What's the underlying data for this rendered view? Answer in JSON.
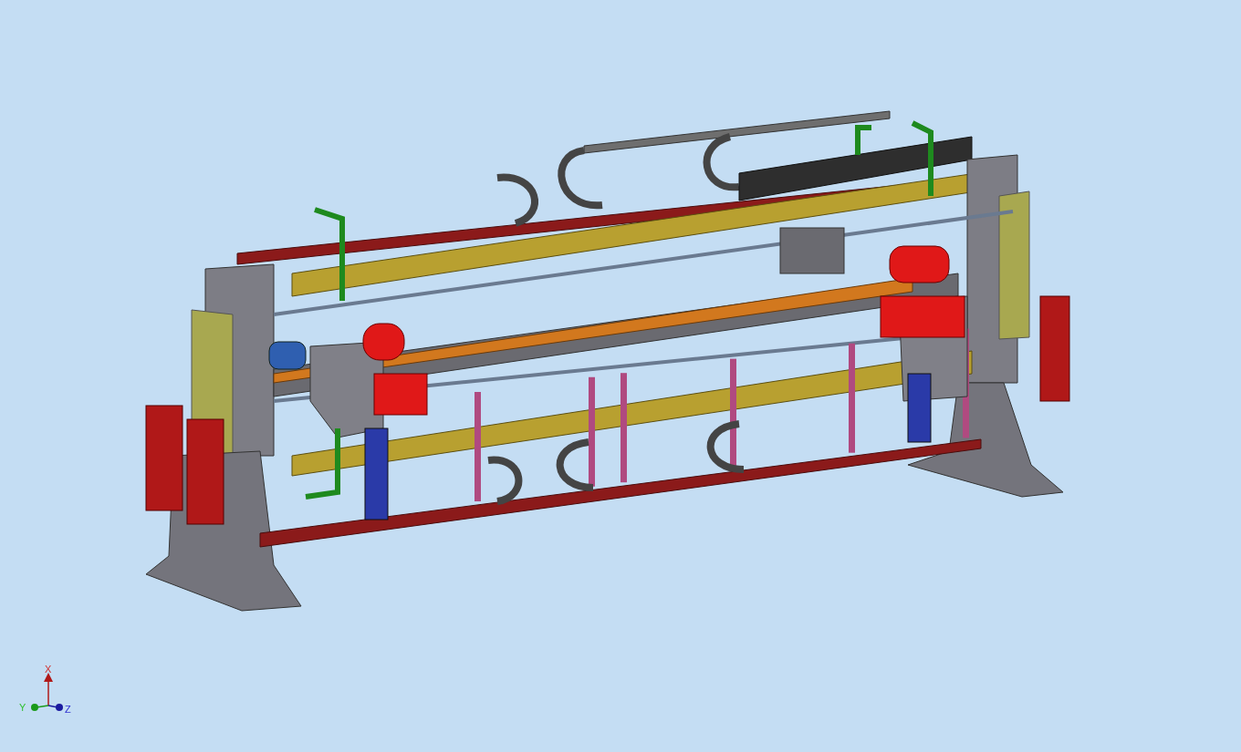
{
  "viewport": {
    "axis_triad": {
      "x_label": "X",
      "y_label": "Y",
      "z_label": "Z"
    }
  }
}
